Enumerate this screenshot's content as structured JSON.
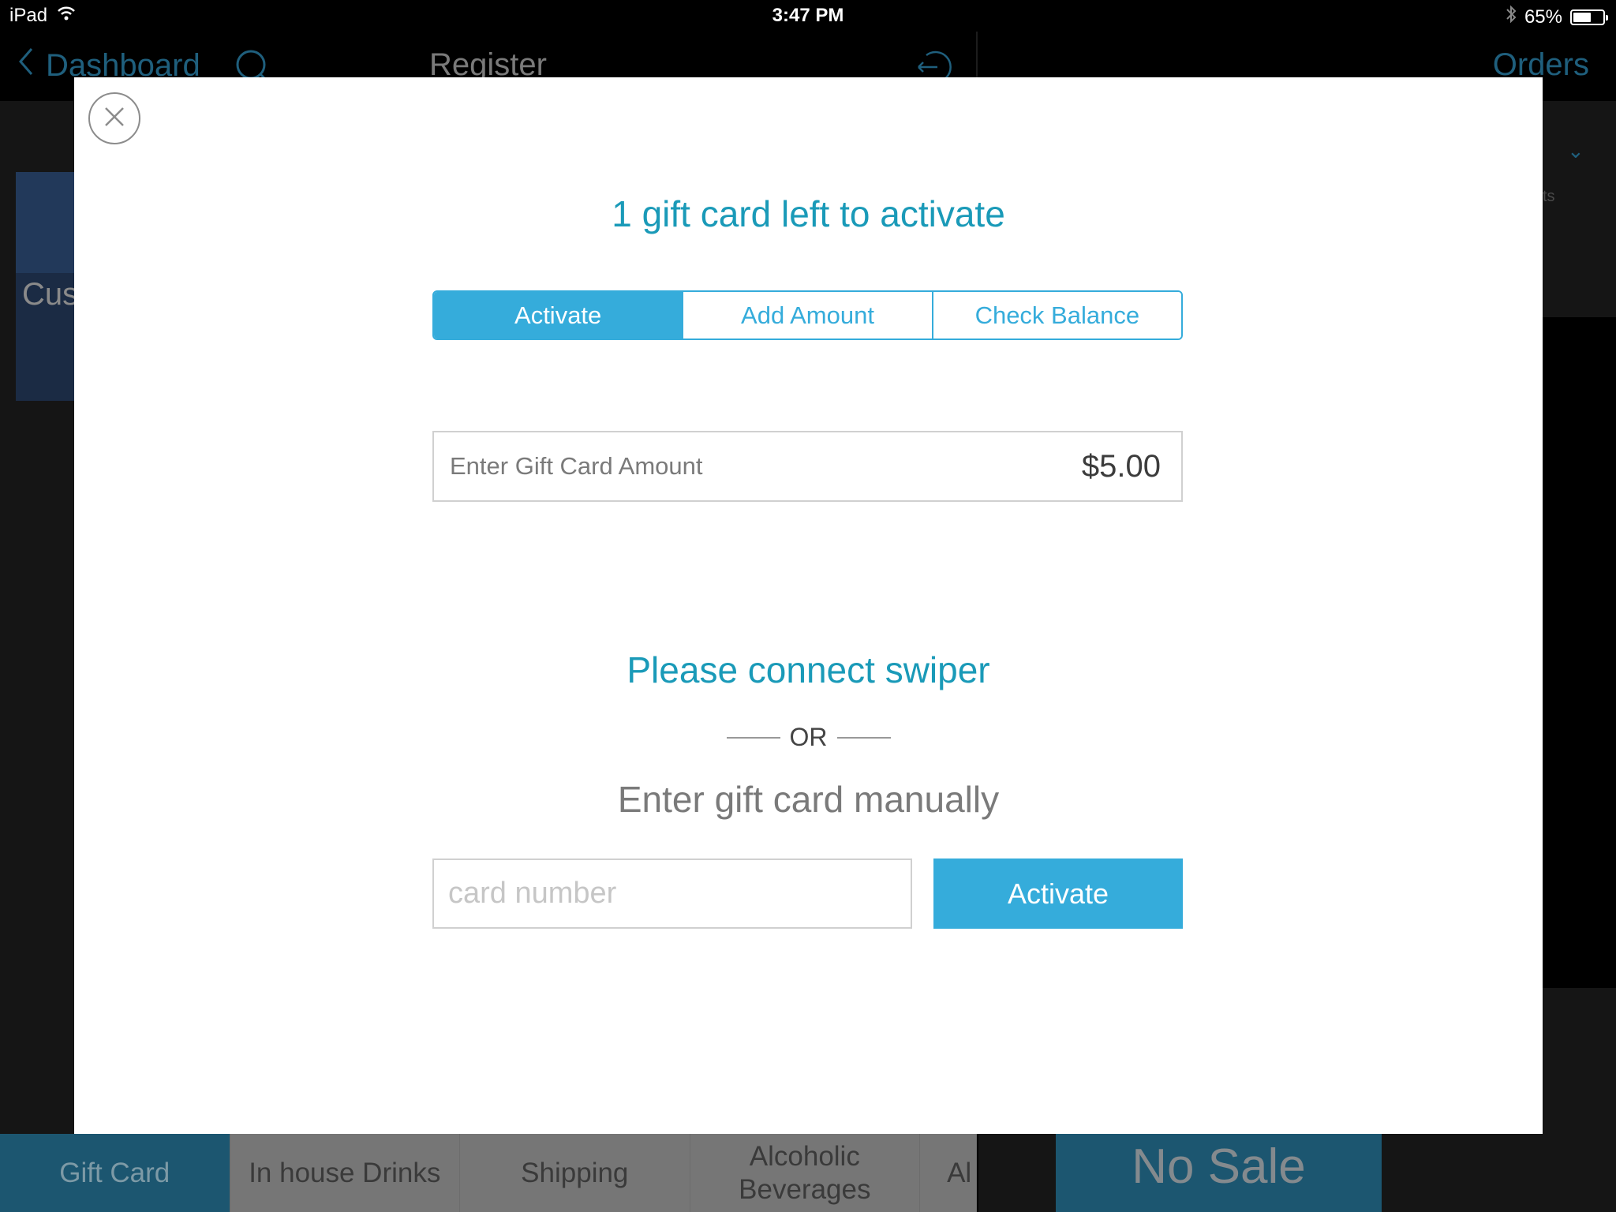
{
  "status_bar": {
    "device": "iPad",
    "time": "3:47 PM",
    "battery_percent_label": "65%",
    "battery_level": 0.65
  },
  "nav": {
    "back_label": "Dashboard",
    "title": "Register",
    "orders_label": "Orders"
  },
  "background": {
    "card_label": "Cus",
    "right_subtext": "ts",
    "right_dropdown_glyph": "⌄"
  },
  "bottom_bar": {
    "categories": [
      {
        "label": "Gift Card",
        "active": true
      },
      {
        "label": "In house Drinks",
        "active": false
      },
      {
        "label": "Shipping",
        "active": false
      },
      {
        "label": "Alcoholic Beverages",
        "active": false
      },
      {
        "label": "Al",
        "active": false
      }
    ],
    "no_sale_label": "No Sale"
  },
  "modal": {
    "title": "1 gift card left to activate",
    "tabs": [
      {
        "label": "Activate",
        "active": true
      },
      {
        "label": "Add Amount",
        "active": false
      },
      {
        "label": "Check Balance",
        "active": false
      }
    ],
    "amount_field": {
      "label": "Enter Gift Card Amount",
      "value": "$5.00"
    },
    "swiper_message": "Please connect swiper",
    "or_label": "OR",
    "manual_label": "Enter gift card manually",
    "card_input": {
      "placeholder": "card number",
      "value": ""
    },
    "activate_button_label": "Activate"
  },
  "colors": {
    "accent": "#35acdb",
    "title_teal": "#1a9ab8",
    "nav_link": "#1f5f7d",
    "category_active": "#1c5670"
  }
}
